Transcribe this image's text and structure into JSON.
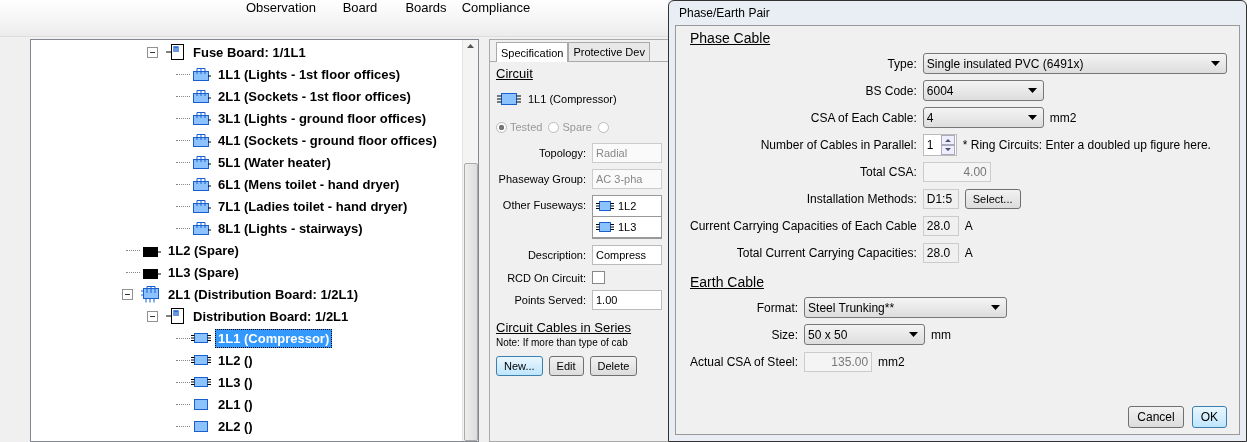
{
  "toolbar": {
    "buttons": [
      "Observation",
      "Board",
      "Boards",
      "Compliance"
    ]
  },
  "tree": {
    "continued_branch": [
      {
        "kind": "board",
        "label": "Fuse Board: 1/1L1",
        "selected": false,
        "expanded": true,
        "children": [
          {
            "kind": "circuit",
            "label": "1L1 (Lights - 1st floor offices)",
            "selected": false
          },
          {
            "kind": "circuit",
            "label": "2L1 (Sockets - 1st floor offices)",
            "selected": false
          },
          {
            "kind": "circuit",
            "label": "3L1 (Lights - ground floor offices)",
            "selected": false
          },
          {
            "kind": "circuit",
            "label": "4L1 (Sockets - ground floor offices)",
            "selected": false
          },
          {
            "kind": "circuit",
            "label": "5L1 (Water heater)",
            "selected": false
          },
          {
            "kind": "circuit",
            "label": "6L1 (Mens toilet - hand dryer)",
            "selected": false
          },
          {
            "kind": "circuit",
            "label": "7L1 (Ladies toilet - hand dryer)",
            "selected": false
          },
          {
            "kind": "circuit",
            "label": "8L1 (Lights - stairways)",
            "selected": false
          }
        ]
      }
    ],
    "items": [
      {
        "kind": "spare",
        "label": "1L2 (Spare)",
        "selected": false
      },
      {
        "kind": "spare",
        "label": "1L3 (Spare)",
        "selected": false
      },
      {
        "kind": "way",
        "label": "2L1 (Distribution Board: 1/2L1)",
        "selected": false,
        "expanded": true,
        "children": [
          {
            "kind": "board",
            "label": "Distribution Board: 1/2L1",
            "selected": false,
            "expanded": true,
            "children": [
              {
                "kind": "fuseway",
                "label": "1L1 (Compressor)",
                "selected": true
              },
              {
                "kind": "fuseway",
                "label": "1L2 ()",
                "selected": false
              },
              {
                "kind": "fuseway",
                "label": "1L3 ()",
                "selected": false
              },
              {
                "kind": "plain",
                "label": "2L1 ()",
                "selected": false
              },
              {
                "kind": "plain",
                "label": "2L2 ()",
                "selected": false
              }
            ]
          }
        ]
      }
    ]
  },
  "circuit_panel": {
    "tabs": [
      {
        "label": "Specification",
        "selected": true
      },
      {
        "label": "Protective Dev",
        "selected": false
      }
    ],
    "heading": "Circuit",
    "circuit": {
      "kind": "fuseway",
      "label": "1L1 (Compressor)"
    },
    "status_disabled": true,
    "status_options": [
      {
        "label": "Tested",
        "selected": true
      },
      {
        "label": "Spare",
        "selected": false
      },
      {
        "selected": false
      }
    ],
    "fields": [
      {
        "kind": "select",
        "label": "Topology:",
        "value": "Radial",
        "disabled": true
      },
      {
        "kind": "select",
        "label": "Phaseway Group:",
        "value": "AC 3-pha",
        "disabled": true
      },
      {
        "kind": "list",
        "label": "Other Fuseways:",
        "items": [
          "1L2",
          "1L3"
        ]
      },
      {
        "kind": "text",
        "label": "Description:",
        "value": "Compress"
      },
      {
        "kind": "checkbox",
        "label": "RCD On Circuit:",
        "checked": false
      },
      {
        "kind": "text",
        "label": "Points Served:",
        "value": "1.00"
      }
    ],
    "cables_heading": "Circuit Cables in Series",
    "note": "Note: If more than type of cab",
    "buttons": [
      {
        "label": "New...",
        "default": true
      },
      {
        "label": "Edit",
        "default": false
      },
      {
        "label": "Delete",
        "default": false
      }
    ]
  },
  "dialog": {
    "title": "Phase/Earth Pair",
    "sections": [
      {
        "heading": "Phase Cable",
        "rows": [
          {
            "kind": "wide_select",
            "label": "Type:",
            "value": "Single insulated PVC (6491x)"
          },
          {
            "kind": "select",
            "label": "BS Code:",
            "value": "6004"
          },
          {
            "kind": "select",
            "label": "CSA of Each Cable:",
            "value": "4",
            "unit": "mm2"
          },
          {
            "kind": "spin",
            "label": "Number of Cables in Parallel:",
            "value": "1",
            "note": "* Ring Circuits: Enter a doubled up figure here."
          },
          {
            "kind": "readonly",
            "label": "Total CSA:",
            "value": "4.00",
            "disabled": true
          },
          {
            "kind": "text_button",
            "label": "Installation Methods:",
            "value": "D1:5",
            "button": "Select..."
          },
          {
            "kind": "readonly",
            "label": "Current Carrying Capacities of Each Cable",
            "value": "28.0",
            "unit": "A",
            "disabled": false
          },
          {
            "kind": "readonly",
            "label": "Total Current Carrying Capacities:",
            "value": "28.0",
            "unit": "A",
            "disabled": false
          }
        ]
      },
      {
        "heading": "Earth Cable",
        "rows": [
          {
            "kind": "medium_select",
            "label": "Format:",
            "value": "Steel Trunking**"
          },
          {
            "kind": "select",
            "label": "Size:",
            "value": "50 x 50",
            "unit": "mm"
          },
          {
            "kind": "readonly",
            "label": "Actual CSA of Steel:",
            "value": "135.00",
            "unit": "mm2",
            "disabled": true
          }
        ]
      }
    ],
    "buttons": [
      {
        "label": "Cancel",
        "default": false
      },
      {
        "label": "OK",
        "default": true
      }
    ]
  }
}
